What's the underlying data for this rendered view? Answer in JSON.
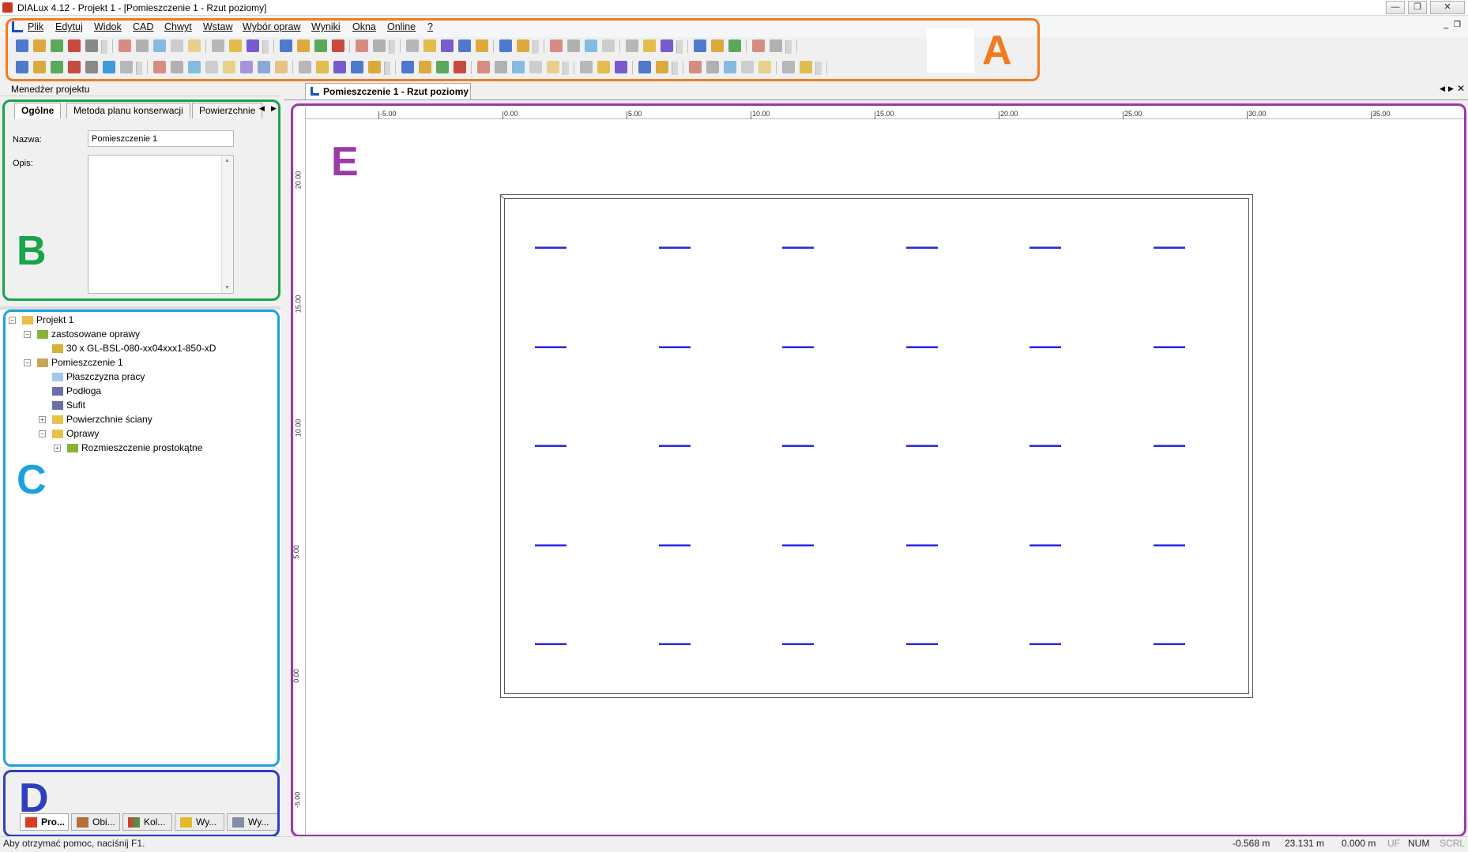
{
  "window": {
    "title": "DIALux 4.12 - Projekt 1 - [Pomieszczenie 1 - Rzut poziomy]",
    "min": "—",
    "restore": "❐",
    "close": "✕"
  },
  "menu": [
    "Plik",
    "Edytuj",
    "Widok",
    "CAD",
    "Chwyt",
    "Wstaw",
    "Wybór opraw",
    "Wyniki",
    "Okna",
    "Online",
    "?"
  ],
  "annotations": {
    "A": "A",
    "B": "B",
    "C": "C",
    "D": "D",
    "E": "E"
  },
  "colors": {
    "A": "#f47a1f",
    "B": "#19a44a",
    "C": "#1aa3e0",
    "D": "#2f3fc0",
    "E": "#9a3aa6",
    "luminaire": "#2b2bd8"
  },
  "project_manager": {
    "title": "Menedżer projektu"
  },
  "props": {
    "tabs": [
      "Ogólne",
      "Metoda planu konserwacji",
      "Powierzchnie"
    ],
    "name_label": "Nazwa:",
    "name_value": "Pomieszczenie 1",
    "desc_label": "Opis:"
  },
  "tree": [
    {
      "label": "Projekt 1",
      "level": 0,
      "icon": "folder-icon"
    },
    {
      "label": "zastosowane oprawy",
      "level": 1,
      "icon": "luminaire-group-icon"
    },
    {
      "label": "30 x GL-BSL-080-xx04xxx1-850-xD",
      "level": 2,
      "icon": "luminaire-icon"
    },
    {
      "label": "Pomieszczenie 1",
      "level": 1,
      "icon": "room-icon"
    },
    {
      "label": "Płaszczyzna pracy",
      "level": 2,
      "icon": "workplane-icon"
    },
    {
      "label": "Podłoga",
      "level": 2,
      "icon": "floor-icon"
    },
    {
      "label": "Sufit",
      "level": 2,
      "icon": "ceiling-icon"
    },
    {
      "label": "Powierzchnie ściany",
      "level": 2,
      "icon": "folder-icon"
    },
    {
      "label": "Oprawy",
      "level": 2,
      "icon": "folder-icon"
    },
    {
      "label": "Rozmieszczenie prostokątne",
      "level": 3,
      "icon": "arrangement-icon"
    }
  ],
  "bottom_tabs": [
    "Pro...",
    "Obi...",
    "Kol...",
    "Wy...",
    "Wy..."
  ],
  "doc_tab": {
    "label": "Pomieszczenie 1 - Rzut poziomy"
  },
  "ruler": {
    "x": [
      "-5.00",
      "0.00",
      "5.00",
      "10.00",
      "15.00",
      "20.00",
      "25.00",
      "30.00",
      "35.00"
    ],
    "y": [
      "20.00",
      "15.00",
      "10.00",
      "5.00",
      "0.00",
      "-5.00"
    ]
  },
  "status": {
    "help": "Aby otrzymać pomoc, naciśnij F1.",
    "x": "-0.568 m",
    "y": "23.131 m",
    "z": "0.000 m",
    "uf": "UF",
    "num": "NUM",
    "scrl": "SCRL"
  }
}
